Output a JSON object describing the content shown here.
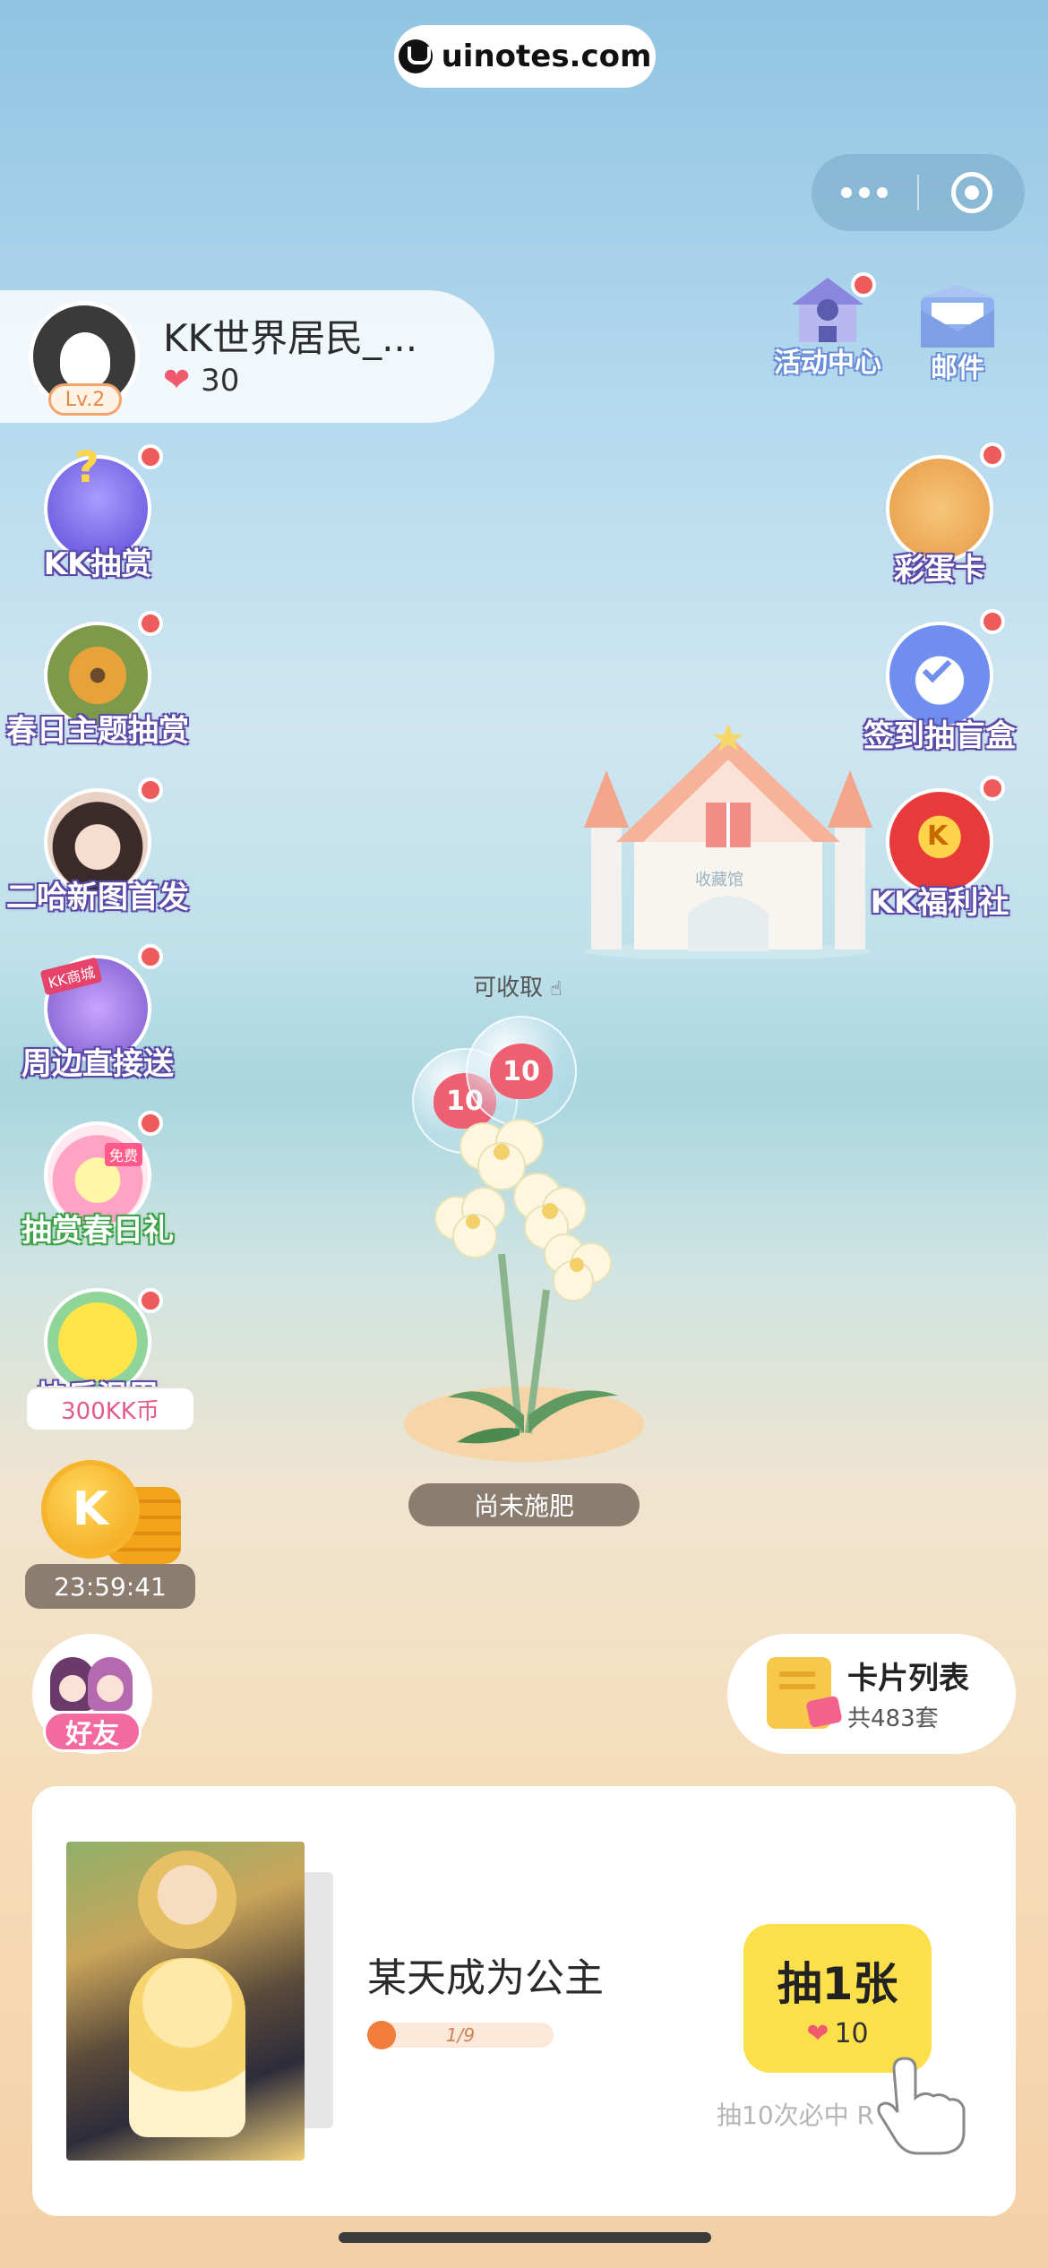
{
  "brand": {
    "label": "uinotes.com"
  },
  "user": {
    "name": "KK世界居民_...",
    "level": "Lv.2",
    "hearts": "30"
  },
  "left_menu": [
    {
      "label": "KK抽赏"
    },
    {
      "label": "春日主题抽赏"
    },
    {
      "label": "二哈新图首发"
    },
    {
      "label": "周边直接送",
      "badge": "KK商城"
    },
    {
      "label": "抽赏春日礼",
      "badge": "免费"
    },
    {
      "label": "快乐温周"
    }
  ],
  "right_menu": [
    {
      "label": "活动中心"
    },
    {
      "label": "邮件"
    },
    {
      "label": "彩蛋卡"
    },
    {
      "label": "签到抽盲盒"
    },
    {
      "label": "KK福利社"
    }
  ],
  "castle": {
    "sign": "收藏馆"
  },
  "plant": {
    "collect_label": "可收取",
    "bubbles": [
      "10",
      "10"
    ],
    "status": "尚未施肥"
  },
  "coins": {
    "reward": "300KK币",
    "coin_letter": "K",
    "timer": "23:59:41"
  },
  "friends": {
    "label": "好友"
  },
  "card_list": {
    "title": "卡片列表",
    "count": "共483套"
  },
  "draw_panel": {
    "manga_title": "某天成为公主",
    "progress_text": "1/9",
    "progress_fraction": 0.111,
    "button_label": "抽1张",
    "button_cost": "10",
    "guarantee": "抽10次必中 R"
  },
  "colors": {
    "accent_yellow": "#fbe04b",
    "heart_red": "#f05a6e",
    "badge_red": "#ef5b5b",
    "status_brown": "#8b7d6f"
  }
}
